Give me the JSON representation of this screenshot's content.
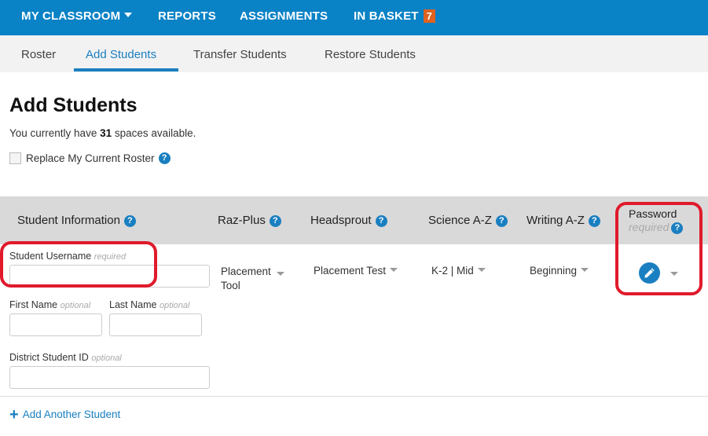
{
  "topnav": {
    "my_classroom": "MY CLASSROOM",
    "reports": "REPORTS",
    "assignments": "ASSIGNMENTS",
    "in_basket": "IN BASKET",
    "in_basket_count": "7"
  },
  "tabs": {
    "roster": "Roster",
    "add_students": "Add Students",
    "transfer_students": "Transfer Students",
    "restore_students": "Restore Students"
  },
  "page": {
    "title": "Add Students",
    "spaces_prefix": "You currently have ",
    "spaces_count": "31",
    "spaces_suffix": " spaces available.",
    "replace_roster": "Replace My Current Roster"
  },
  "table_header": {
    "student_information": "Student Information",
    "raz_plus": "Raz-Plus",
    "headsprout": "Headsprout",
    "science_az": "Science A-Z",
    "writing_az": "Writing A-Z",
    "password": "Password",
    "password_required": "required"
  },
  "form": {
    "username_label": "Student Username",
    "username_required": "required",
    "first_name_label": "First Name",
    "last_name_label": "Last Name",
    "optional": "optional",
    "district_id_label": "District Student ID",
    "raz_plus_value_line1": "Placement",
    "raz_plus_value_line2": "Tool",
    "headsprout_value": "Placement Test",
    "science_az_value": "K-2 | Mid",
    "writing_az_value": "Beginning"
  },
  "add_another": "Add Another Student",
  "help_glyph": "?",
  "colors": {
    "nav_blue": "#0a82c6",
    "accent_blue": "#1a7fc1",
    "badge_orange": "#e0621e",
    "highlight_red": "#e01a2b",
    "header_gray": "#d9d9d9"
  }
}
